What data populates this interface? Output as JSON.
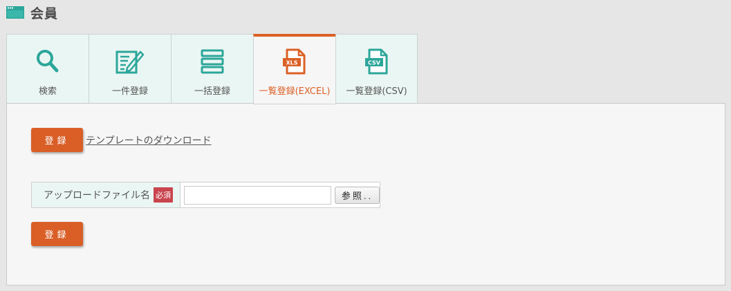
{
  "header": {
    "title": "会員",
    "icon": "window-icon",
    "accent_color": "#2ca69a"
  },
  "tabs": [
    {
      "label": "検索",
      "icon": "search-icon",
      "active": false
    },
    {
      "label": "一件登録",
      "icon": "edit-form-icon",
      "active": false
    },
    {
      "label": "一括登録",
      "icon": "list-rows-icon",
      "active": false
    },
    {
      "label": "一覧登録(EXCEL)",
      "icon": "xls-file-icon",
      "icon_text": "XLS",
      "active": true
    },
    {
      "label": "一覧登録(CSV)",
      "icon": "csv-file-icon",
      "icon_text": "CSV",
      "active": false
    }
  ],
  "panel": {
    "register_button_label": "登録",
    "template_link": "テンプレートのダウンロード",
    "upload": {
      "label": "アップロードファイル名",
      "required_badge": "必須",
      "file_value": "",
      "browse_label": "参照.."
    },
    "bottom_register_button_label": "登録"
  },
  "colors": {
    "tab_teal": "#2ca69a",
    "active_orange": "#db6026",
    "button_orange": "#d95f27",
    "required_red": "#c9444e"
  }
}
